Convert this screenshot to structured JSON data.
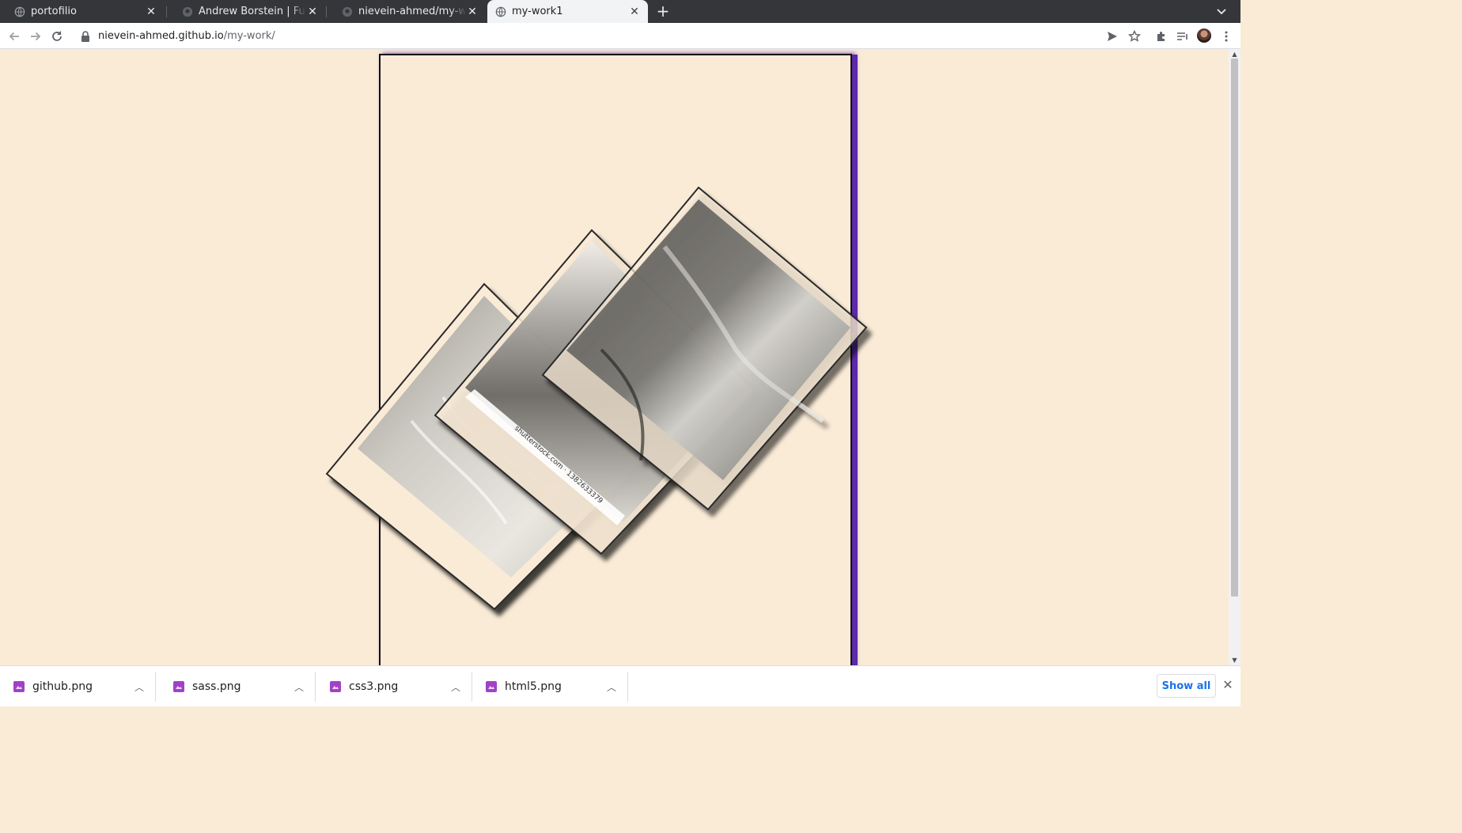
{
  "browser": {
    "tabs": [
      {
        "title": "portofilio",
        "icon": "globe-icon",
        "active": false
      },
      {
        "title": "Andrew Borstein | Full-Stack Developer",
        "icon": "github-icon",
        "active": false
      },
      {
        "title": "nievein-ahmed/my-work: my-work",
        "icon": "github-icon",
        "active": false
      },
      {
        "title": "my-work1",
        "icon": "globe-icon",
        "active": true
      }
    ],
    "new_tab_label": "+",
    "address": {
      "host": "nievein-ahmed.github.io",
      "path": "/my-work/"
    }
  },
  "page": {
    "watermark": "shutterstock.com · 1382633379",
    "colors": {
      "background": "#faebd7",
      "frame_border": "#111111",
      "frame_shadow": "#5b2aa8"
    }
  },
  "downloads": {
    "items": [
      {
        "name": "github.png"
      },
      {
        "name": "sass.png"
      },
      {
        "name": "css3.png"
      },
      {
        "name": "html5.png"
      }
    ],
    "show_all_label": "Show all"
  }
}
